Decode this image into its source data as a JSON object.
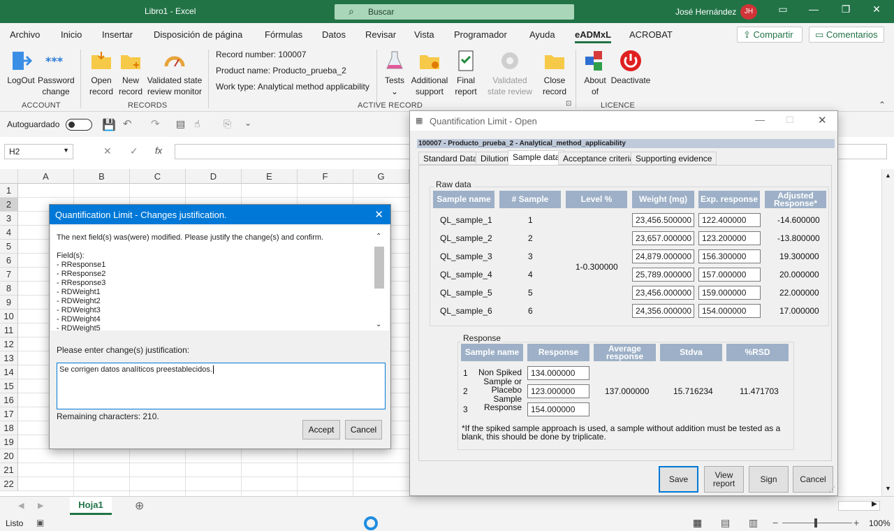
{
  "titlebar": {
    "title": "Libro1  -  Excel",
    "search_placeholder": "Buscar",
    "user": "José Hernández",
    "avatar": "JH"
  },
  "menu": {
    "tabs": [
      "Archivo",
      "Inicio",
      "Insertar",
      "Disposición de página",
      "Fórmulas",
      "Datos",
      "Revisar",
      "Vista",
      "Programador",
      "Ayuda",
      "eADMxL",
      "ACROBAT"
    ],
    "share": "Compartir",
    "comments": "Comentarios"
  },
  "ribbon": {
    "logout": "LogOut",
    "password": "Password change",
    "open": "Open record",
    "new": "New record",
    "validated_monitor": "Validated state review monitor",
    "record_number": "Record number: 100007",
    "product_name": "Product name: Producto_prueba_2",
    "work_type": "Work type: Analytical method applicability",
    "tests": "Tests",
    "additional": "Additional support",
    "final": "Final report",
    "validated_review": "Validated state review",
    "close": "Close record",
    "about": "About of",
    "deactivate": "Deactivate",
    "groups": {
      "account": "ACCOUNT",
      "records": "RECORDS",
      "active": "ACTIVE RECORD",
      "licence": "LICENCE"
    }
  },
  "qat": {
    "autosave": "Autoguardado"
  },
  "formula": {
    "namebox": "H2",
    "fx": "fx"
  },
  "grid": {
    "columns": [
      "A",
      "B",
      "C",
      "D",
      "E",
      "F",
      "G"
    ],
    "rows": [
      "1",
      "2",
      "3",
      "4",
      "5",
      "6",
      "7",
      "8",
      "9",
      "10",
      "11",
      "12",
      "13",
      "14",
      "15",
      "16",
      "17",
      "18",
      "19",
      "20",
      "21",
      "22"
    ]
  },
  "sheet": {
    "tab": "Hoja1"
  },
  "status": {
    "ready": "Listo",
    "zoom": "100%"
  },
  "dialog_justify": {
    "title": "Quantification Limit - Changes justification.",
    "intro": "The next field(s) was(were) modified. Please justify the change(s) and confirm.",
    "fields_label": "Field(s):",
    "fields": [
      "- RResponse1",
      "- RResponse2",
      "- RResponse3",
      "- RDWeight1",
      "- RDWeight2",
      "- RDWeight3",
      "- RDWeight4",
      "- RDWeight5"
    ],
    "prompt": "Please enter change(s) justification:",
    "text": "Se corrigen datos analíticos preestablecidos.",
    "remaining": "Remaining characters: 210.",
    "accept": "Accept",
    "cancel": "Cancel"
  },
  "dialog_ql": {
    "title": "Quantification Limit  - Open",
    "header": "100007 - Producto_prueba_2 - Analytical_method_applicability",
    "tabs": [
      "Standard Data",
      "Dilution",
      "Sample data",
      "Acceptance criteria",
      "Supporting evidence"
    ],
    "raw_label": "Raw data",
    "raw_cols": [
      "Sample name",
      "# Sample",
      "Level %",
      "Weight (mg)",
      "Exp. response",
      "Adjusted Response*"
    ],
    "level": "1-0.300000",
    "raw_rows": [
      {
        "name": "QL_sample_1",
        "num": "1",
        "weight": "23,456.500000",
        "exp": "122.400000",
        "adj": "-14.600000"
      },
      {
        "name": "QL_sample_2",
        "num": "2",
        "weight": "23,657.000000",
        "exp": "123.200000",
        "adj": "-13.800000"
      },
      {
        "name": "QL_sample_3",
        "num": "3",
        "weight": "24,879.000000",
        "exp": "156.300000",
        "adj": "19.300000"
      },
      {
        "name": "QL_sample_4",
        "num": "4",
        "weight": "25,789.000000",
        "exp": "157.000000",
        "adj": "20.000000"
      },
      {
        "name": "QL_sample_5",
        "num": "5",
        "weight": "23,456.000000",
        "exp": "159.000000",
        "adj": "22.000000"
      },
      {
        "name": "QL_sample_6",
        "num": "6",
        "weight": "24,356.000000",
        "exp": "154.000000",
        "adj": "17.000000"
      }
    ],
    "resp_label": "Response",
    "resp_cols": [
      "Sample name",
      "Response",
      "Average response",
      "Stdva",
      "%RSD"
    ],
    "resp_nums": [
      "1",
      "2",
      "3"
    ],
    "resp_name_lines": [
      "Non Spiked",
      "Sample or",
      "Placebo",
      "Sample",
      "Response"
    ],
    "resp_values": [
      "134.000000",
      "123.000000",
      "154.000000"
    ],
    "average": "137.000000",
    "stdva": "15.716234",
    "rsd": "11.471703",
    "note": "*If the spiked sample approach is used, a sample without addition must be tested as a blank, this should be done by triplicate.",
    "buttons": {
      "save": "Save",
      "view": "View report",
      "sign": "Sign",
      "cancel": "Cancel"
    }
  }
}
